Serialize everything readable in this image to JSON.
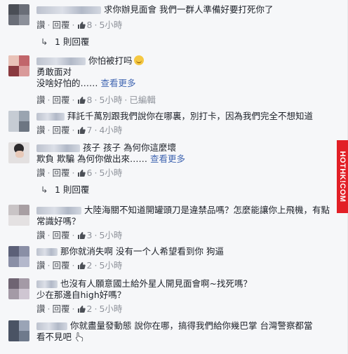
{
  "actions": {
    "reply": "讚",
    "respond": "回覆",
    "dot": "·"
  },
  "more_label": "查看更多",
  "watermark": "HOTHK!COM",
  "comments": [
    {
      "lines": [
        "求你辦見面會 我們一群人準備好要打死你了"
      ],
      "likes": "8",
      "time": "5小時",
      "replies": "1 則回覆"
    },
    {
      "lines": [
        "你怕被打吗",
        "勇敢面对",
        "没啥好怕的……"
      ],
      "likes": "8",
      "time": "5小時",
      "edited": "已編輯"
    },
    {
      "lines": [
        "拜託千萬別跟我們說你在哪裏，別打卡，因為我們完全不想知道"
      ],
      "likes": "7",
      "time": "4小時"
    },
    {
      "lines": [
        "孩子 孩子 為何你這麼壞",
        "欺負 欺騙 為何你做出來……"
      ],
      "likes": "6",
      "time": "5小時",
      "replies": "1 則回覆"
    },
    {
      "lines": [
        "大陸海關不知道開罐頭刀是違禁品嗎？怎麼能讓你上飛機，有點",
        "常識好嗎？"
      ],
      "likes": "3",
      "time": "5小時"
    },
    {
      "lines": [
        "那你就消失啊 没有一个人希望看到你 狗逼"
      ],
      "likes": "2",
      "time": "5小時"
    },
    {
      "lines": [
        "也沒有人願意國土給外星人開見面會啊~找死嗎？",
        "少在那邊自high好嗎？"
      ],
      "likes": "2",
      "time": "5小時"
    },
    {
      "lines": [
        "你就盡量發動態 說你在哪，搞得我們給你幾巴掌 台灣警察都當",
        "看不見吧"
      ]
    }
  ],
  "colors": {
    "background": "#f6f7f9",
    "link": "#4267b2",
    "meta": "#90949c",
    "watermark": "#e21f26"
  }
}
